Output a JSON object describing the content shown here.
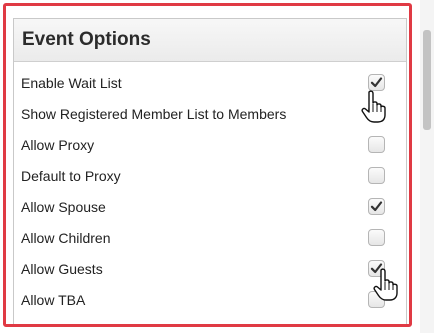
{
  "panel": {
    "title": "Event Options"
  },
  "options": [
    {
      "label": "Enable Wait List",
      "checked": true
    },
    {
      "label": "Show Registered Member List to Members",
      "checked": false
    },
    {
      "label": "Allow Proxy",
      "checked": false
    },
    {
      "label": "Default to Proxy",
      "checked": false
    },
    {
      "label": "Allow Spouse",
      "checked": true
    },
    {
      "label": "Allow Children",
      "checked": false
    },
    {
      "label": "Allow Guests",
      "checked": true
    },
    {
      "label": "Allow TBA",
      "checked": false
    }
  ],
  "colors": {
    "highlight_border": "#e03a44",
    "checkmark": "#333333"
  },
  "icons": {
    "cursor": "hand-pointer-icon",
    "check": "checkmark-icon"
  }
}
